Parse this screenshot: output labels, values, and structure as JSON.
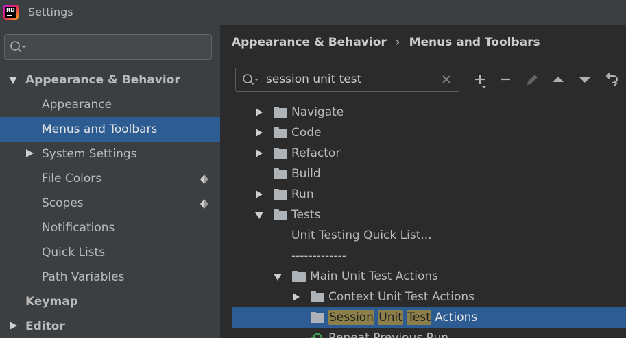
{
  "window": {
    "title": "Settings",
    "logo_text": "RD"
  },
  "sidebar": {
    "search": {
      "value": "",
      "placeholder": ""
    },
    "items": [
      {
        "label": "Appearance & Behavior",
        "expanded": true
      },
      {
        "label": "Appearance"
      },
      {
        "label": "Menus and Toolbars",
        "selected": true
      },
      {
        "label": "System Settings"
      },
      {
        "label": "File Colors"
      },
      {
        "label": "Scopes"
      },
      {
        "label": "Notifications"
      },
      {
        "label": "Quick Lists"
      },
      {
        "label": "Path Variables"
      },
      {
        "label": "Keymap"
      },
      {
        "label": "Editor"
      }
    ]
  },
  "breadcrumb": {
    "parent": "Appearance & Behavior",
    "separator": "›",
    "current": "Menus and Toolbars"
  },
  "action_search": {
    "value": "session unit test"
  },
  "toolbar": {
    "buttons": [
      "add-icon",
      "remove-icon",
      "edit-icon",
      "move-up-icon",
      "move-down-icon",
      "restore-icon"
    ]
  },
  "actions_tree": {
    "items": [
      {
        "label": "Navigate"
      },
      {
        "label": "Code"
      },
      {
        "label": "Refactor"
      },
      {
        "label": "Build"
      },
      {
        "label": "Run"
      },
      {
        "label": "Tests"
      },
      {
        "label": "Unit Testing Quick List..."
      },
      {
        "label": "-------------"
      },
      {
        "label": "Main Unit Test Actions"
      },
      {
        "label": "Context Unit Test Actions"
      },
      {
        "label_parts": [
          "Session",
          "Unit",
          "Test",
          "Actions"
        ]
      },
      {
        "label": "Repeat Previous Run"
      }
    ]
  },
  "colors": {
    "sidebar_bg": "#3c3f41",
    "main_bg": "#2b2b2b",
    "selection": "#2d5c93",
    "search_highlight": "#8c7f4a"
  }
}
